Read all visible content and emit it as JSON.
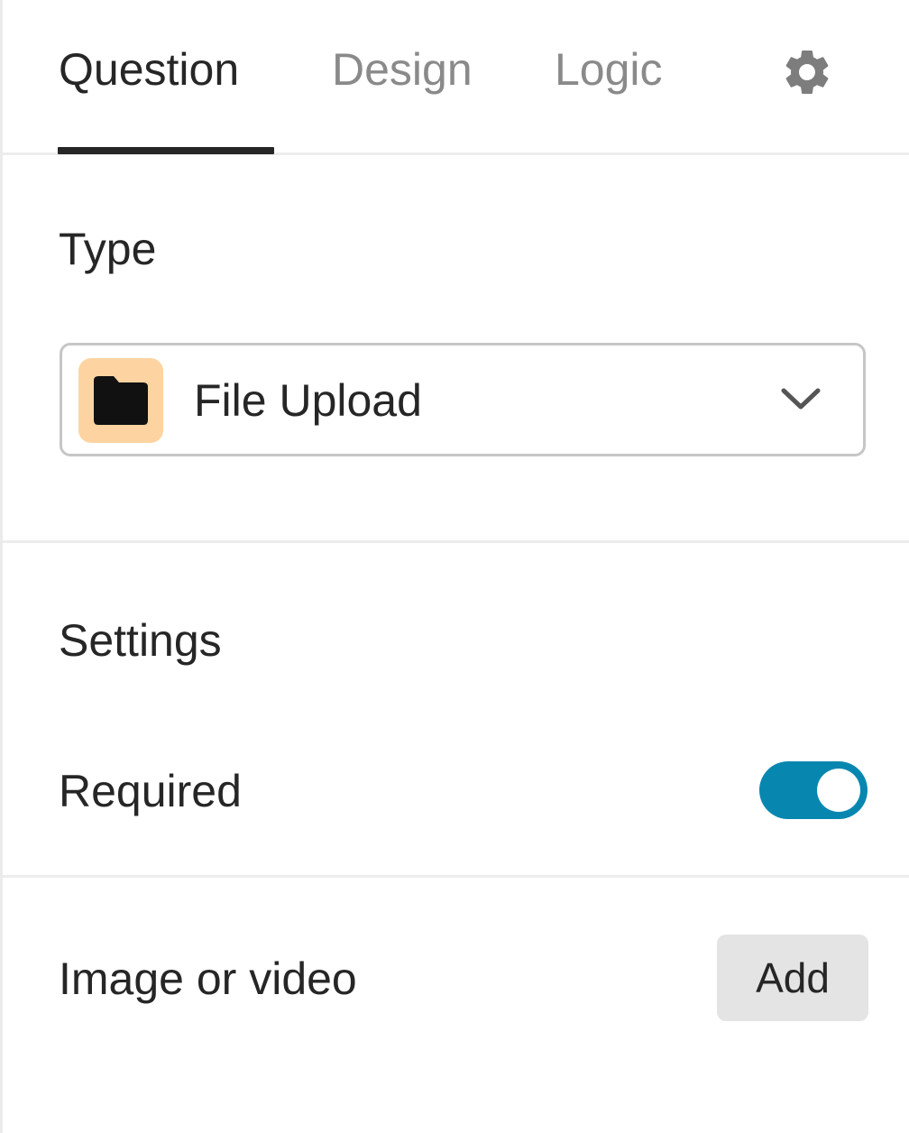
{
  "tabs": {
    "question": "Question",
    "design": "Design",
    "logic": "Logic",
    "active": "question",
    "settings_icon": "gear-icon"
  },
  "type_section": {
    "title": "Type",
    "select": {
      "value": "File Upload",
      "icon": "folder-icon",
      "icon_bg_color": "#fdd4a1",
      "dropdown_icon": "chevron-down-icon"
    }
  },
  "settings_section": {
    "title": "Settings",
    "required": {
      "label": "Required",
      "enabled": true,
      "toggle_color": "#0787b0"
    }
  },
  "media_section": {
    "label": "Image or video",
    "add_label": "Add"
  }
}
